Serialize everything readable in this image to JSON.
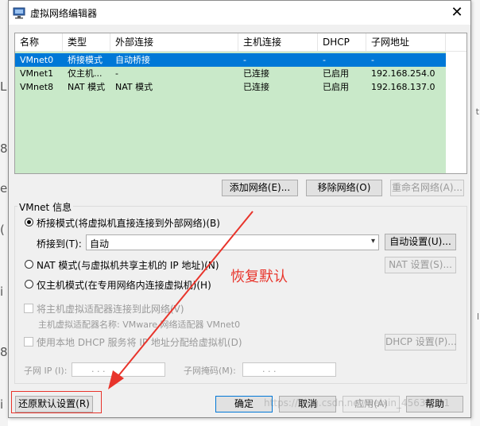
{
  "window": {
    "title": "虚拟网络编辑器",
    "close_glyph": "✕"
  },
  "table": {
    "headers": [
      "名称",
      "类型",
      "外部连接",
      "主机连接",
      "DHCP",
      "子网地址"
    ],
    "rows": [
      {
        "name": "VMnet0",
        "type": "桥接模式",
        "external": "自动桥接",
        "host": "-",
        "dhcp": "-",
        "subnet": "-"
      },
      {
        "name": "VMnet1",
        "type": "仅主机...",
        "external": "-",
        "host": "已连接",
        "dhcp": "已启用",
        "subnet": "192.168.254.0"
      },
      {
        "name": "VMnet8",
        "type": "NAT 模式",
        "external": "NAT 模式",
        "host": "已连接",
        "dhcp": "已启用",
        "subnet": "192.168.137.0"
      }
    ]
  },
  "table_buttons": {
    "add": "添加网络(E)...",
    "remove": "移除网络(O)",
    "rename": "重命名网络(A)..."
  },
  "vmnet_info": {
    "title": "VMnet 信息",
    "bridged_label": "桥接模式(将虚拟机直接连接到外部网络)(B)",
    "bridge_to_label": "桥接到(T):",
    "bridge_to_value": "自动",
    "auto_settings": "自动设置(U)...",
    "nat_label": "NAT 模式(与虚拟机共享主机的 IP 地址)(N)",
    "nat_settings": "NAT 设置(S)...",
    "hostonly_label": "仅主机模式(在专用网络内连接虚拟机)(H)",
    "connect_adapter_label": "将主机虚拟适配器连接到此网络(V)",
    "adapter_name_label": "主机虚拟适配器名称: VMware 网络适配器 VMnet0",
    "dhcp_label": "使用本地 DHCP 服务将 IP 地址分配给虚拟机(D)",
    "dhcp_settings": "DHCP 设置(P)...",
    "subnet_ip_label": "子网 IP (I):",
    "subnet_mask_label": "子网掩码(M):",
    "ip_dots": ".       .       ."
  },
  "bottom_buttons": {
    "restore": "还原默认设置(R)",
    "ok": "确定",
    "cancel": "取消",
    "apply": "应用(A)",
    "help": "帮助"
  },
  "annotation": {
    "text": "恢复默认",
    "color": "#e8342b"
  },
  "watermark": "https://blog.csdn.net/weixin_45634891",
  "colors": {
    "selected_row": "#0078d7",
    "table_body": "#c9e9c9",
    "dialog_bg": "#f0f0f0"
  }
}
